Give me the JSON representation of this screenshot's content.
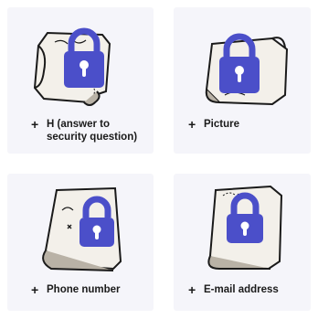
{
  "options": [
    {
      "label": "H (answer to security question)",
      "icon": "lock-icon"
    },
    {
      "label": "Picture",
      "icon": "lock-icon"
    },
    {
      "label": "Phone number",
      "icon": "lock-icon"
    },
    {
      "label": "E-mail address",
      "icon": "lock-icon"
    }
  ],
  "colors": {
    "lock": "#4b4fc9",
    "card_bg": "#f5f5fa",
    "map_paper": "#f3f0ea",
    "map_shadow": "#b9b2a6",
    "ink": "#1a1a1a"
  },
  "plus_symbol": "+"
}
